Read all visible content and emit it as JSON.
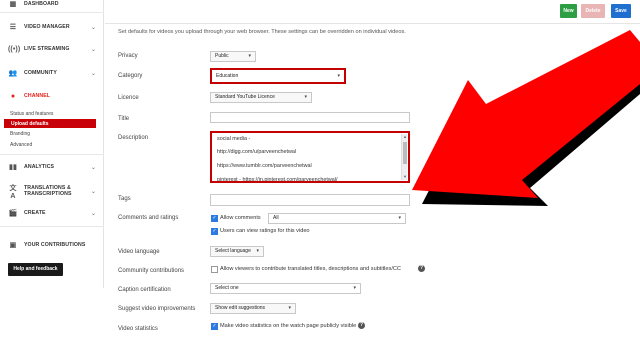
{
  "sidebar": {
    "dashboard": "DASHBOARD",
    "video_manager": "VIDEO MANAGER",
    "live_streaming": "LIVE STREAMING",
    "community": "COMMUNITY",
    "channel": "CHANNEL",
    "channel_items": [
      "Status and features",
      "Upload defaults",
      "Branding",
      "Advanced"
    ],
    "analytics": "ANALYTICS",
    "translations_line1": "TRANSLATIONS &",
    "translations_line2": "TRANSCRIPTIONS",
    "create": "CREATE",
    "your_contributions": "YOUR CONTRIBUTIONS",
    "help_button": "Help and feedback"
  },
  "header": {
    "new_label": "New",
    "delete_label": "Delete",
    "save_label": "Save"
  },
  "intro": "Set defaults for videos you upload through your web browser. These settings can be overridden on individual videos.",
  "form": {
    "privacy_label": "Privacy",
    "privacy_value": "Public",
    "category_label": "Category",
    "category_value": "Education",
    "licence_label": "Licence",
    "licence_value": "Standard YouTube Licence",
    "title_label": "Title",
    "description_label": "Description",
    "description_lines": [
      "social media -",
      "http://digg.com/u/parveenchetwal",
      "https://www.tumblr.com/parveenchetwal",
      "pinterest - https://in.pinterest.com/parveenchetwal/"
    ],
    "tags_label": "Tags",
    "comments_label": "Comments and ratings",
    "allow_comments": "Allow comments",
    "comments_value": "All",
    "users_ratings": "Users can view ratings for this video",
    "video_language_label": "Video language",
    "video_language_value": "Select language",
    "community_contrib_label": "Community contributions",
    "community_contrib_text": "Allow viewers to contribute translated titles, descriptions and subtitles/CC",
    "caption_label": "Caption certification",
    "caption_value": "Select one",
    "suggest_label": "Suggest video improvements",
    "suggest_value": "Show edit suggestions",
    "stats_label": "Video statistics",
    "stats_text": "Make video statistics on the watch page publicly visible"
  },
  "colors": {
    "accent_red": "#c40000",
    "new_green": "#2e9e44",
    "save_blue": "#1f6fd1",
    "arrow_red": "#ff0000"
  }
}
